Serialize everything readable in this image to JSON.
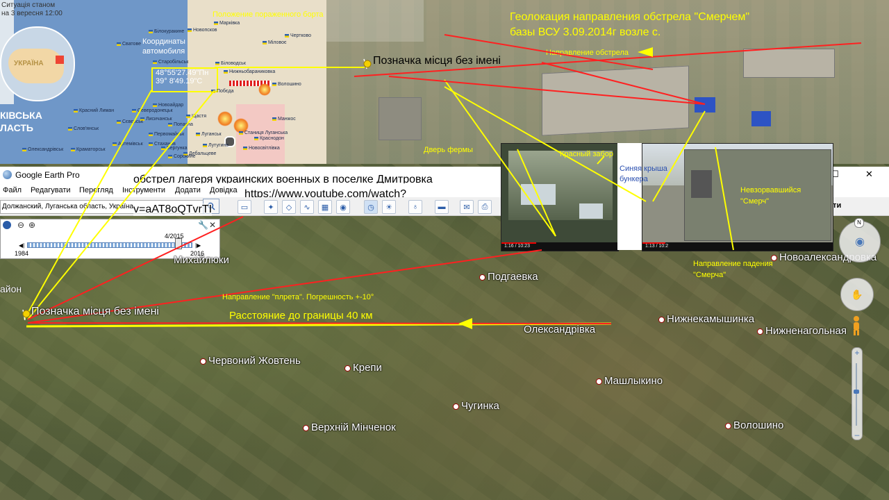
{
  "map": {
    "situation": "Ситуація станом",
    "situation_date": "на 3 вересня 12:00",
    "ukraine_label": "УКРАЇНА",
    "oblast_label_1": "КІВСЬКА",
    "oblast_label_2": "ЛАСТЬ",
    "coords_caption_1": "Координаты",
    "coords_caption_2": "автомобиля",
    "coord_lat": "48°55'27.49\"Пн",
    "coord_lon": "39° 8'49.19\"С",
    "wreck_note": "Положение пораженного борта",
    "towns": [
      "Марківка",
      "Біловодськ",
      "Новопсков",
      "Білокуракине",
      "Сватове",
      "Старобільськ",
      "Міловоє",
      "Чертково",
      "Нижньобараниковка",
      "Северодонецьк",
      "Новоайдар",
      "Щастя",
      "Лисичанськ",
      "Луганськ",
      "Красний Лиман",
      "Слов'янськ",
      "Краматорськ",
      "Олександрівськ",
      "Дебальцеве",
      "Вергунка",
      "Первомайськ",
      "Стаханов",
      "Сєвєрськ",
      "Артемівськ",
      "Попасна",
      "Волошино",
      "Побєда",
      "Станиця Луганська",
      "Новосвітлівка",
      "Манжос",
      "Краснодон",
      "Сорокине",
      "Лутугине"
    ]
  },
  "photo": {
    "title_line1": "Геолокация направления обстрела \"Смерчем\"",
    "title_line2": "базы ВСУ 3.09.2014г возле с.",
    "direction_label": "Направление обстрела",
    "placemark": "Позначка місця без імені",
    "farm_door": "Дверь фермы",
    "red_fence": "Красный забор",
    "blue_roof_1": "Синяя крыша",
    "blue_roof_2": "бункера",
    "unexploded_1": "Невзорвавшийся",
    "unexploded_2": "\"Смерч\"",
    "fall_direction_1": "Направление падения",
    "fall_direction_2": "\"Смерча\""
  },
  "window": {
    "app_title": "Google Earth Pro",
    "overlay_title": "обстрел лагеря украинских военных в поселке Дмитровка",
    "overlay_url_1": "https://www.youtube.com/watch?",
    "overlay_url_2": "v=aAT8oQTvrTI",
    "menus": [
      "Файл",
      "Редагувати",
      "Перегляд",
      "Інструменти",
      "Додати",
      "Довідка"
    ],
    "search_value": "Должанский, Луганська область, Україна",
    "right_edge_label": "іти",
    "controls": {
      "minimize": "–",
      "maximize": "☐",
      "close": "✕"
    }
  },
  "history": {
    "start_year": "1984",
    "end_year": "2016",
    "current_date": "4/2015",
    "slider_position": 0.92
  },
  "video1": {
    "time": "1:16 / 10:23"
  },
  "video2": {
    "time": "1:13 / 10:2"
  },
  "main_map": {
    "placemark": "Позначка місця без імені",
    "volley_direction": "Направление \"плрета\". Погрешность +-10°",
    "distance": "Расстояние до границы 40 км",
    "left_edge": "айон",
    "places": [
      {
        "name": "Михайлюки"
      },
      {
        "name": "Подгаевка"
      },
      {
        "name": "Новоалександровка"
      },
      {
        "name": "Нижнекамышинка"
      },
      {
        "name": "Олександрівка"
      },
      {
        "name": "Нижненагольная"
      },
      {
        "name": "Червоний Жовтень"
      },
      {
        "name": "Крепи"
      },
      {
        "name": "Машлыкино"
      },
      {
        "name": "Чугинка"
      },
      {
        "name": "Верхній Мінченок"
      },
      {
        "name": "Волошино"
      }
    ]
  },
  "colors": {
    "annotation": "#ffff00",
    "arrow": "#ff2020",
    "map_blue": "#6f97c8"
  },
  "icons": [
    "globe-icon",
    "search-icon",
    "clock-icon",
    "zoom-out-icon",
    "zoom-in-icon",
    "wrench-icon",
    "close-icon",
    "placemark-icon",
    "pegman-icon",
    "compass-icon",
    "hand-icon"
  ]
}
